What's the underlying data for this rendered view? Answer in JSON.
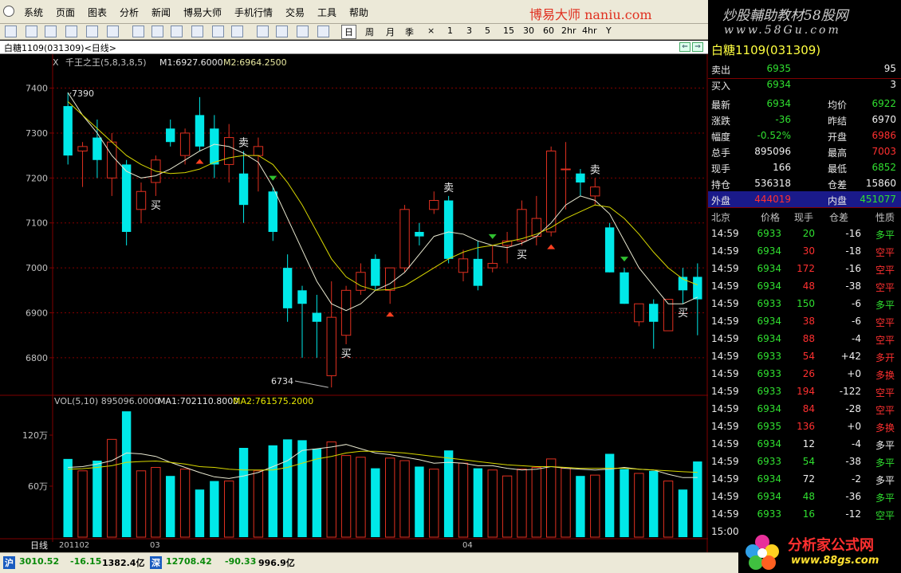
{
  "menu": [
    "系统",
    "页面",
    "图表",
    "分析",
    "新闻",
    "博易大师",
    "手机行情",
    "交易",
    "工具",
    "帮助"
  ],
  "brand_text": "博易大师 naniu.com",
  "banner": {
    "line1": "炒股輔助教材58股网",
    "line2": "www.58Gu.com"
  },
  "toolbar_periods": [
    "日",
    "周",
    "月",
    "季",
    "×",
    "1",
    "3",
    "5",
    "15",
    "30",
    "60",
    "2hr",
    "4hr",
    "Y"
  ],
  "toolbar_active_period": "日",
  "chart_title": "白糖1109(031309)<日线>",
  "indicator_line": {
    "prefix": "X",
    "name": "千王之王(5,8,3,8,5)",
    "m1": "M1:6927.6000",
    "m2": "M2:6964.2500"
  },
  "vol_line": {
    "head": "VOL(5,10) 895096.0000",
    "ma1": "MA1:702110.8000",
    "ma2": "MA2:761575.2000"
  },
  "x_axis": {
    "period_label": "日线",
    "dates": [
      "201102",
      "03",
      "04"
    ]
  },
  "colors": {
    "bull": "#e03020",
    "bear": "#00e8e8",
    "ma1": "#e8e8d0",
    "ma2": "#d8d800",
    "grid": "#800000",
    "red": "#ff3030",
    "green": "#30e030",
    "yellow": "#ffff40"
  },
  "chart_data": [
    {
      "type": "candlestick",
      "y_ticks": [
        7400,
        7300,
        7200,
        7100,
        7000,
        6900,
        6800
      ],
      "ylim": [
        6720,
        7440
      ],
      "annotations": {
        "high": "7390",
        "low": "6734"
      },
      "candles": [
        {
          "o": 7360,
          "h": 7390,
          "l": 7230,
          "c": 7250
        },
        {
          "o": 7260,
          "h": 7280,
          "l": 7180,
          "c": 7270
        },
        {
          "o": 7290,
          "h": 7330,
          "l": 7200,
          "c": 7240
        },
        {
          "o": 7200,
          "h": 7300,
          "l": 7160,
          "c": 7280
        },
        {
          "o": 7230,
          "h": 7240,
          "l": 7050,
          "c": 7080
        },
        {
          "o": 7130,
          "h": 7190,
          "l": 7100,
          "c": 7170
        },
        {
          "o": 7190,
          "h": 7250,
          "l": 7160,
          "c": 7240
        },
        {
          "o": 7310,
          "h": 7330,
          "l": 7270,
          "c": 7280
        },
        {
          "o": 7250,
          "h": 7310,
          "l": 7230,
          "c": 7300
        },
        {
          "o": 7340,
          "h": 7380,
          "l": 7260,
          "c": 7270
        },
        {
          "o": 7310,
          "h": 7340,
          "l": 7200,
          "c": 7230
        },
        {
          "o": 7230,
          "h": 7320,
          "l": 7190,
          "c": 7290
        },
        {
          "o": 7210,
          "h": 7260,
          "l": 7100,
          "c": 7140
        },
        {
          "o": 7250,
          "h": 7290,
          "l": 7170,
          "c": 7270
        },
        {
          "o": 7170,
          "h": 7180,
          "l": 7060,
          "c": 7080
        },
        {
          "o": 7000,
          "h": 7030,
          "l": 6880,
          "c": 6910
        },
        {
          "o": 6950,
          "h": 6960,
          "l": 6800,
          "c": 6920
        },
        {
          "o": 6900,
          "h": 6940,
          "l": 6800,
          "c": 6880
        },
        {
          "o": 6760,
          "h": 6970,
          "l": 6734,
          "c": 6890
        },
        {
          "o": 6850,
          "h": 6960,
          "l": 6830,
          "c": 6950
        },
        {
          "o": 6950,
          "h": 7010,
          "l": 6940,
          "c": 6990
        },
        {
          "o": 7020,
          "h": 7030,
          "l": 6950,
          "c": 6960
        },
        {
          "o": 6950,
          "h": 7000,
          "l": 6920,
          "c": 7000
        },
        {
          "o": 7000,
          "h": 7140,
          "l": 6990,
          "c": 7130
        },
        {
          "o": 7080,
          "h": 7100,
          "l": 7050,
          "c": 7070
        },
        {
          "o": 7130,
          "h": 7170,
          "l": 7120,
          "c": 7150
        },
        {
          "o": 7150,
          "h": 7160,
          "l": 7010,
          "c": 7020
        },
        {
          "o": 6990,
          "h": 7040,
          "l": 6970,
          "c": 7020
        },
        {
          "o": 7020,
          "h": 7060,
          "l": 6950,
          "c": 6960
        },
        {
          "o": 7000,
          "h": 7050,
          "l": 6990,
          "c": 7010
        },
        {
          "o": 7050,
          "h": 7080,
          "l": 7010,
          "c": 7060
        },
        {
          "o": 7060,
          "h": 7150,
          "l": 7050,
          "c": 7130
        },
        {
          "o": 7070,
          "h": 7160,
          "l": 7050,
          "c": 7110
        },
        {
          "o": 7080,
          "h": 7270,
          "l": 7070,
          "c": 7260
        },
        {
          "o": 7220,
          "h": 7280,
          "l": 7130,
          "c": 7220
        },
        {
          "o": 7210,
          "h": 7220,
          "l": 7160,
          "c": 7190
        },
        {
          "o": 7160,
          "h": 7200,
          "l": 7140,
          "c": 7180
        },
        {
          "o": 7090,
          "h": 7100,
          "l": 6990,
          "c": 6990
        },
        {
          "o": 6990,
          "h": 7000,
          "l": 6920,
          "c": 6920
        },
        {
          "o": 6880,
          "h": 6920,
          "l": 6870,
          "c": 6920
        },
        {
          "o": 6920,
          "h": 6930,
          "l": 6820,
          "c": 6880
        },
        {
          "o": 6860,
          "h": 6930,
          "l": 6860,
          "c": 6930
        },
        {
          "o": 6980,
          "h": 7000,
          "l": 6920,
          "c": 6950
        },
        {
          "o": 6980,
          "h": 7010,
          "l": 6850,
          "c": 6930
        }
      ],
      "ma1": [
        7390,
        7340,
        7300,
        7250,
        7215,
        7200,
        7205,
        7220,
        7240,
        7260,
        7275,
        7270,
        7255,
        7235,
        7180,
        7110,
        7040,
        6970,
        6920,
        6905,
        6920,
        6950,
        6965,
        6990,
        7030,
        7070,
        7080,
        7075,
        7060,
        7050,
        7045,
        7055,
        7070,
        7100,
        7140,
        7160,
        7150,
        7120,
        7060,
        7000,
        6960,
        6920,
        6920,
        6935
      ],
      "ma2": [
        7370,
        7340,
        7310,
        7280,
        7250,
        7230,
        7215,
        7210,
        7212,
        7220,
        7235,
        7245,
        7250,
        7250,
        7230,
        7190,
        7140,
        7080,
        7020,
        6980,
        6960,
        6950,
        6952,
        6960,
        6980,
        7000,
        7020,
        7035,
        7045,
        7050,
        7058,
        7065,
        7075,
        7090,
        7110,
        7125,
        7140,
        7135,
        7110,
        7075,
        7035,
        7000,
        6975,
        6962
      ],
      "signals": [
        {
          "i": 6,
          "text": "买"
        },
        {
          "i": 12,
          "text": "卖"
        },
        {
          "i": 19,
          "text": "买"
        },
        {
          "i": 26,
          "text": "卖"
        },
        {
          "i": 31,
          "text": "买"
        },
        {
          "i": 36,
          "text": "卖"
        },
        {
          "i": 42,
          "text": "买"
        }
      ],
      "arrows": [
        {
          "i": 9,
          "dir": "up"
        },
        {
          "i": 14,
          "dir": "down"
        },
        {
          "i": 22,
          "dir": "up"
        },
        {
          "i": 29,
          "dir": "down"
        },
        {
          "i": 33,
          "dir": "up"
        },
        {
          "i": 38,
          "dir": "down"
        }
      ]
    },
    {
      "type": "bar",
      "y_ticks_labels": [
        "120万",
        "60万"
      ],
      "y_ticks": [
        1200000,
        600000
      ],
      "ylim": [
        0,
        1500000
      ],
      "volumes": [
        920000,
        780000,
        900000,
        1150000,
        1480000,
        780000,
        820000,
        720000,
        800000,
        560000,
        660000,
        660000,
        1050000,
        780000,
        1080000,
        1150000,
        1140000,
        1040000,
        1120000,
        960000,
        940000,
        810000,
        930000,
        900000,
        830000,
        800000,
        1020000,
        870000,
        810000,
        790000,
        720000,
        800000,
        820000,
        920000,
        810000,
        720000,
        730000,
        980000,
        800000,
        750000,
        780000,
        660000,
        560000,
        890000
      ],
      "ma1": [
        820000,
        830000,
        860000,
        900000,
        990000,
        980000,
        950000,
        880000,
        820000,
        760000,
        710000,
        690000,
        720000,
        760000,
        830000,
        900000,
        1020000,
        1040000,
        1060000,
        1090000,
        1040000,
        990000,
        970000,
        940000,
        910000,
        870000,
        880000,
        870000,
        840000,
        840000,
        810000,
        790000,
        800000,
        830000,
        810000,
        800000,
        790000,
        800000,
        820000,
        800000,
        790000,
        740000,
        700000,
        702110
      ],
      "ma2": [
        800000,
        805000,
        820000,
        840000,
        880000,
        890000,
        895000,
        880000,
        860000,
        830000,
        820000,
        800000,
        790000,
        790000,
        790000,
        820000,
        870000,
        920000,
        950000,
        990000,
        1010000,
        1010000,
        1000000,
        990000,
        970000,
        950000,
        930000,
        910000,
        890000,
        870000,
        850000,
        840000,
        830000,
        830000,
        820000,
        810000,
        810000,
        810000,
        810000,
        800000,
        790000,
        780000,
        770000,
        761575
      ]
    }
  ],
  "quote": {
    "title": "白糖1109(031309)",
    "rows": [
      {
        "l": "卖出",
        "v": "6935",
        "vc": "green",
        "r": "95",
        "rc": "white"
      },
      {
        "l": "买入",
        "v": "6934",
        "vc": "green",
        "r": "3",
        "rc": "white"
      },
      {
        "l": "最新",
        "v": "6934",
        "vc": "green",
        "l2": "均价",
        "r": "6922",
        "rc": "green"
      },
      {
        "l": "涨跌",
        "v": "-36",
        "vc": "green",
        "l2": "昨结",
        "r": "6970",
        "rc": "white"
      },
      {
        "l": "幅度",
        "v": "-0.52%",
        "vc": "green",
        "l2": "开盘",
        "r": "6986",
        "rc": "red"
      },
      {
        "l": "总手",
        "v": "895096",
        "vc": "white",
        "l2": "最高",
        "r": "7003",
        "rc": "red"
      },
      {
        "l": "现手",
        "v": "166",
        "vc": "white",
        "l2": "最低",
        "r": "6852",
        "rc": "green"
      },
      {
        "l": "持仓",
        "v": "536318",
        "vc": "white",
        "l2": "仓差",
        "r": "15860",
        "rc": "white"
      },
      {
        "l": "外盘",
        "v": "444019",
        "vc": "red",
        "l2": "内盘",
        "r": "451077",
        "rc": "green"
      }
    ],
    "tick_header": [
      "北京",
      "价格",
      "现手",
      "仓差",
      "性质"
    ],
    "ticks": [
      {
        "t": "14:59",
        "p": "6933",
        "pc": "green",
        "q": "20",
        "qc": "green",
        "d": "-16",
        "n": "多平",
        "nc": "green"
      },
      {
        "t": "14:59",
        "p": "6934",
        "pc": "green",
        "q": "30",
        "qc": "red",
        "d": "-18",
        "n": "空平",
        "nc": "red"
      },
      {
        "t": "14:59",
        "p": "6934",
        "pc": "green",
        "q": "172",
        "qc": "red",
        "d": "-16",
        "n": "空平",
        "nc": "red"
      },
      {
        "t": "14:59",
        "p": "6934",
        "pc": "green",
        "q": "48",
        "qc": "red",
        "d": "-38",
        "n": "空平",
        "nc": "red"
      },
      {
        "t": "14:59",
        "p": "6933",
        "pc": "green",
        "q": "150",
        "qc": "green",
        "d": "-6",
        "n": "多平",
        "nc": "green"
      },
      {
        "t": "14:59",
        "p": "6934",
        "pc": "green",
        "q": "38",
        "qc": "red",
        "d": "-6",
        "n": "空平",
        "nc": "red"
      },
      {
        "t": "14:59",
        "p": "6934",
        "pc": "green",
        "q": "88",
        "qc": "red",
        "d": "-4",
        "n": "空平",
        "nc": "red"
      },
      {
        "t": "14:59",
        "p": "6933",
        "pc": "green",
        "q": "54",
        "qc": "red",
        "d": "+42",
        "n": "多开",
        "nc": "red"
      },
      {
        "t": "14:59",
        "p": "6933",
        "pc": "green",
        "q": "26",
        "qc": "red",
        "d": "+0",
        "n": "多换",
        "nc": "red"
      },
      {
        "t": "14:59",
        "p": "6933",
        "pc": "green",
        "q": "194",
        "qc": "red",
        "d": "-122",
        "n": "空平",
        "nc": "red"
      },
      {
        "t": "14:59",
        "p": "6934",
        "pc": "green",
        "q": "84",
        "qc": "red",
        "d": "-28",
        "n": "空平",
        "nc": "red"
      },
      {
        "t": "14:59",
        "p": "6935",
        "pc": "green",
        "q": "136",
        "qc": "red",
        "d": "+0",
        "n": "多换",
        "nc": "red"
      },
      {
        "t": "14:59",
        "p": "6934",
        "pc": "green",
        "q": "12",
        "qc": "white",
        "d": "-4",
        "n": "多平",
        "nc": "white"
      },
      {
        "t": "14:59",
        "p": "6933",
        "pc": "green",
        "q": "54",
        "qc": "green",
        "d": "-38",
        "n": "多平",
        "nc": "green"
      },
      {
        "t": "14:59",
        "p": "6934",
        "pc": "green",
        "q": "72",
        "qc": "white",
        "d": "-2",
        "n": "多平",
        "nc": "white"
      },
      {
        "t": "14:59",
        "p": "6934",
        "pc": "green",
        "q": "48",
        "qc": "green",
        "d": "-36",
        "n": "多平",
        "nc": "green"
      },
      {
        "t": "14:59",
        "p": "6933",
        "pc": "green",
        "q": "16",
        "qc": "green",
        "d": "-12",
        "n": "空平",
        "nc": "green"
      },
      {
        "t": "15:00",
        "p": "",
        "pc": "green",
        "q": "",
        "qc": "white",
        "d": "",
        "n": "",
        "nc": "white"
      }
    ]
  },
  "statusbar": {
    "sh_icon": "沪",
    "sh_index": "3010.52",
    "sh_chg": "-16.15",
    "sh_amt": "1382.4亿",
    "sz_icon": "深",
    "sz_index": "12708.42",
    "sz_chg": "-90.33",
    "sz_amt": "996.9亿"
  },
  "logo88": {
    "line1": "分析家公式网",
    "line2": "www.88gs.com"
  }
}
